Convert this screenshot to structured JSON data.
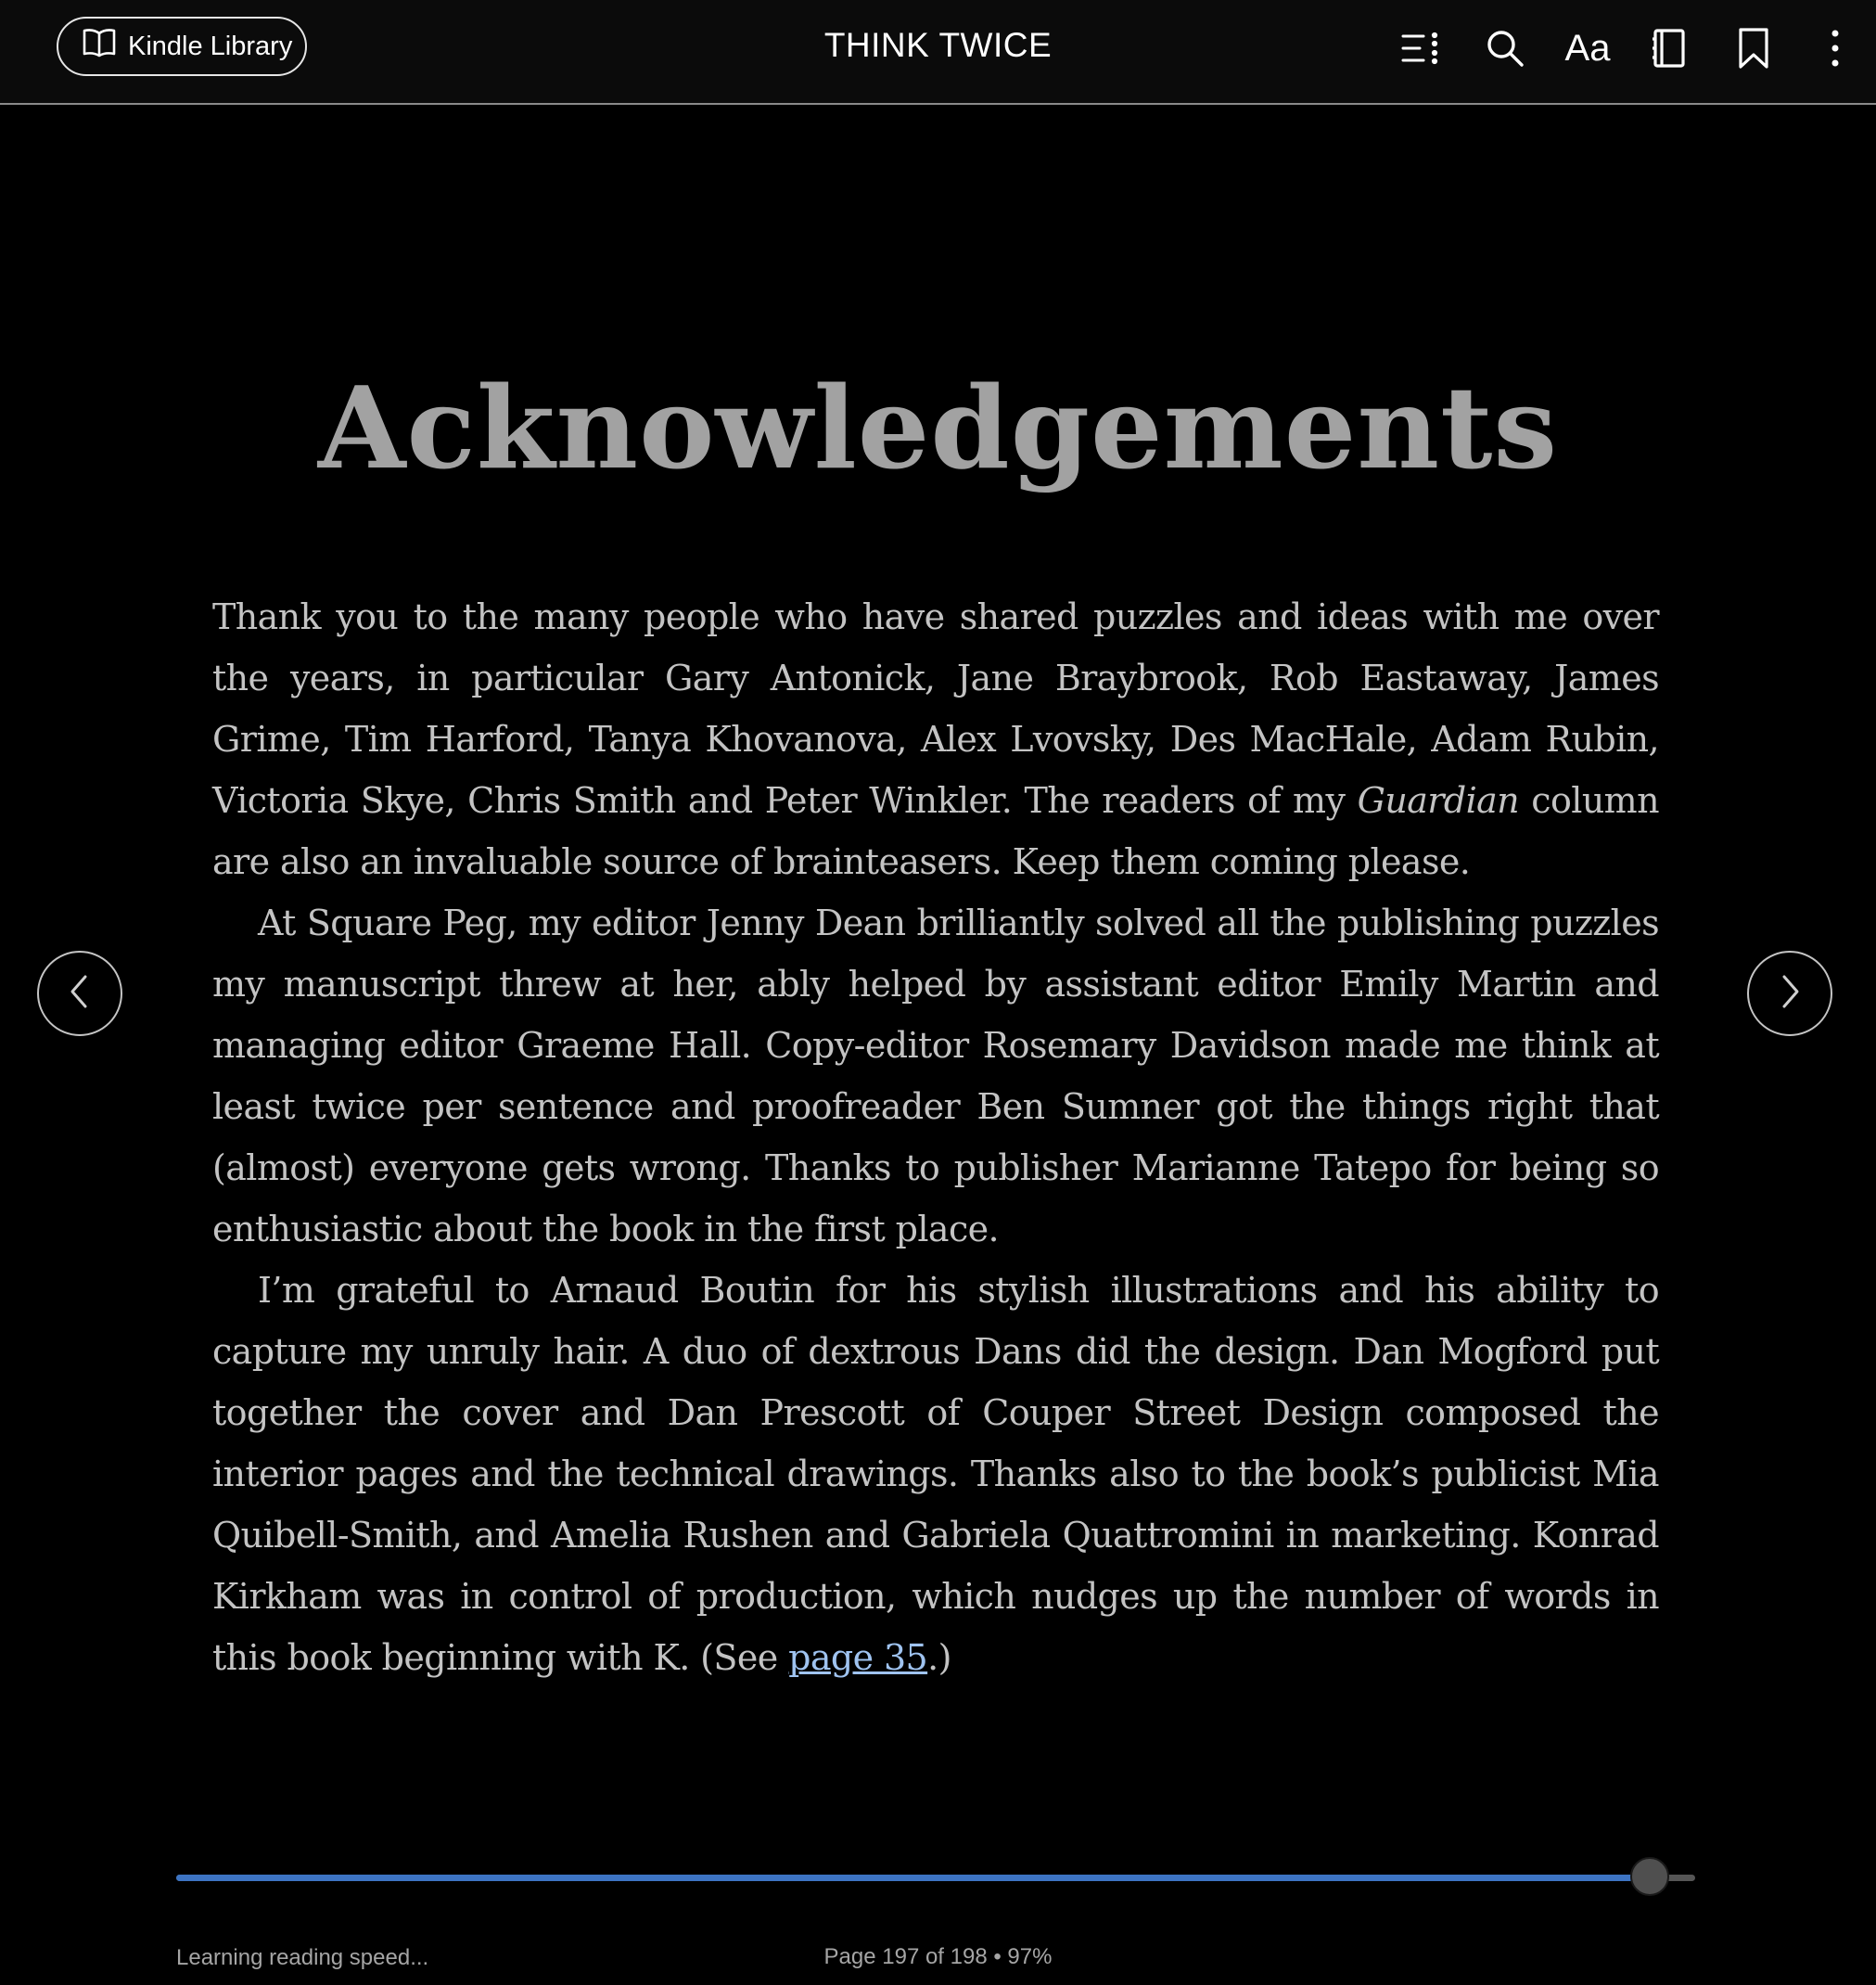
{
  "header": {
    "library_label": "Kindle Library",
    "book_title": "THINK TWICE",
    "font_button_label": "Aa",
    "icons": [
      "book-open-icon",
      "table-of-contents-icon",
      "search-icon",
      "font-settings-icon",
      "notebook-icon",
      "bookmark-icon",
      "more-options-icon"
    ]
  },
  "page": {
    "chapter_title": "Acknowledgements",
    "p1_a": "Thank you to the many people who have shared puzzles and ideas with me over the years, in particular Gary Antonick, Jane Braybrook, Rob Eastaway, James Grime, Tim Harford, Tanya Khovanova, Alex Lvovsky, Des MacHale, Adam Rubin, Victoria Skye, Chris Smith and Peter Winkler. The readers of my ",
    "p1_em": "Guardian",
    "p1_b": " column are also an invaluable source of brainteasers. Keep them coming please.",
    "p2": "At Square Peg, my editor Jenny Dean brilliantly solved all the publishing puzzles my manuscript threw at her, ably helped by assistant editor Emily Martin and managing editor Graeme Hall. Copy-editor Rosemary Davidson made me think at least twice per sentence and proofreader Ben Sumner got the things right that (almost) everyone gets wrong. Thanks to publisher Marianne Tatepo for being so enthusiastic about the book in the first place.",
    "p3_a": "I’m grateful to Arnaud Boutin for his stylish illustrations and his ability to capture my unruly hair. A duo of dextrous Dans did the design. Dan Mogford put together the cover and Dan Prescott of Couper Street Design composed the interior pages and the technical drawings. Thanks also to the book’s publicist Mia Quibell-Smith, and Amelia Rushen and Gabriela Quattromini in marketing. Konrad Kirkham was in control of production, which nudges up the number of words in this book beginning with K. (See ",
    "p3_link": "page 35",
    "p3_b": ".)"
  },
  "navigation": {
    "prev_icon": "chevron-left-icon",
    "next_icon": "chevron-right-icon"
  },
  "footer": {
    "reading_speed": "Learning reading speed...",
    "page_status": "Page 197 of 198 • 97%",
    "progress": 0.97
  },
  "colors": {
    "background": "#000000",
    "accent": "#3d74c3",
    "link": "#9fc3f0"
  }
}
